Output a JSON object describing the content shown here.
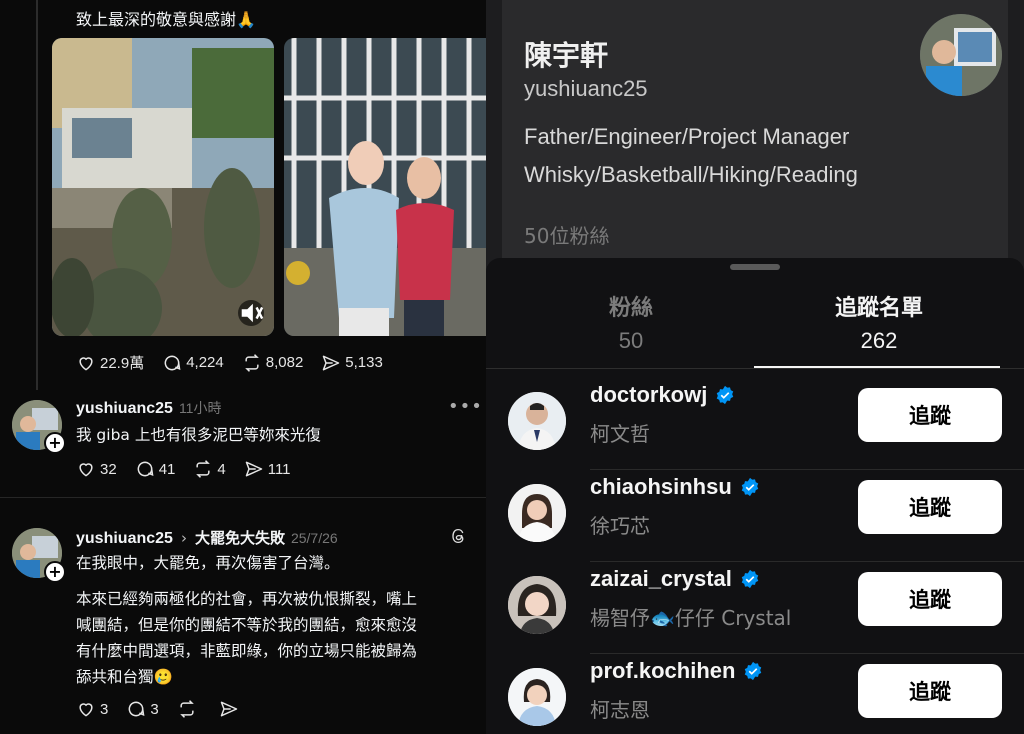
{
  "post": {
    "caption": "致上最深的敬意與感謝🙏",
    "stats": {
      "likes": "22.9萬",
      "comments": "4,224",
      "reposts": "8,082",
      "shares": "5,133"
    }
  },
  "reply1": {
    "username": "yushiuanc25",
    "time": "11小時",
    "text": "我 giba 上也有很多泥巴等妳來光復",
    "stats": {
      "likes": "32",
      "comments": "41",
      "reposts": "4",
      "shares": "111"
    }
  },
  "post2": {
    "username": "yushiuanc25",
    "topic": "大罷免大失敗",
    "date": "25/7/26",
    "line1": "在我眼中，大罷免，再次傷害了台灣。",
    "para": [
      "本來已經夠兩極化的社會，再次被仇恨撕裂，嘴上",
      "喊團結，但是你的團結不等於我的團結，愈來愈沒",
      "有什麼中間選項，非藍即綠，你的立場只能被歸為",
      "舔共和台獨🥲"
    ],
    "stats": {
      "likes": "3",
      "comments": "3"
    }
  },
  "profile": {
    "name": "陳宇軒",
    "handle": "yushiuanc25",
    "bio": [
      "Father/Engineer/Project Manager",
      "Whisky/Basketball/Hiking/Reading"
    ],
    "followers_text": "50位粉絲"
  },
  "tabs": {
    "followers": {
      "label": "粉絲",
      "count": "50"
    },
    "following": {
      "label": "追蹤名單",
      "count": "262"
    }
  },
  "following_list": [
    {
      "username": "doctorkowj",
      "name": "柯文哲",
      "button": "追蹤"
    },
    {
      "username": "chiaohsinhsu",
      "name": "徐巧芯",
      "button": "追蹤"
    },
    {
      "username": "zaizai_crystal",
      "name": "楊智伃🐟仔仔 Crystal",
      "button": "追蹤"
    },
    {
      "username": "prof.kochihen",
      "name": "柯志恩",
      "button": "追蹤"
    }
  ],
  "colors": {
    "verified": "#0095f6",
    "background": "#0a0a0a",
    "sheet": "#111113"
  },
  "icons": [
    "heart-icon",
    "comment-icon",
    "repost-icon",
    "share-icon",
    "mute-icon",
    "more-icon",
    "threads-logo-icon",
    "chevron-right-icon",
    "verified-icon",
    "plus-icon"
  ]
}
